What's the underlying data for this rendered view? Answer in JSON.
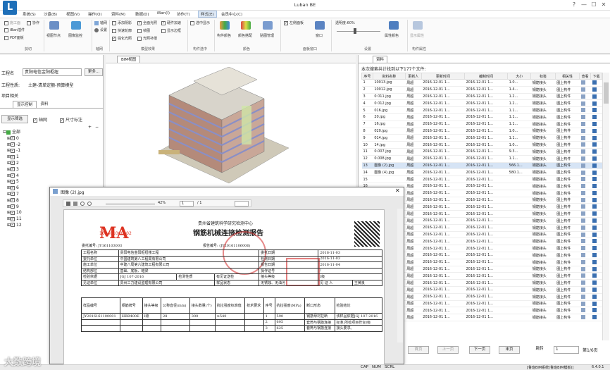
{
  "app": {
    "logo": "L",
    "title": "Luban BE"
  },
  "window_controls": {
    "help": "?",
    "min": "—",
    "max": "☐",
    "close": "✕"
  },
  "menu": [
    "系统(S)",
    "沙盘(B)",
    "视图(V)",
    "操作(O)",
    "资料(M)",
    "数据(D)",
    "iBan(I)",
    "协作(T)",
    "样式(E)",
    "会员中心(C)"
  ],
  "ribbon": {
    "groups": [
      "剪切",
      "轴网",
      "模型效果",
      "构件选中",
      "颜色",
      "面板窗口",
      "设置",
      "构件属性"
    ],
    "items": {
      "cut": "施工面",
      "xiezuo": "协作",
      "iban": "iBan插件",
      "pdf": "PDF面板",
      "jiedian": "视图节点",
      "monitor": "图像监控",
      "axis": "轴网",
      "setting": "设置",
      "add_shadow": "添加阴影",
      "full_light": "全面光照",
      "hard_accel": "硬件加速",
      "select_show": "选中显示",
      "fast_outline": "快速轮廓",
      "frame": "帧图",
      "show_border": "显示边框",
      "strong_light": "强化光照",
      "light_ratio": "光照补偿",
      "struct_color": "构件颜色",
      "color_scheme": "颜色搭配",
      "paint": "贴图管理",
      "left_panel": "左侧面板",
      "window": "窗口",
      "transparency": "透明度:60%",
      "prop_color": "属性颜色",
      "prop_info": "显示属性"
    }
  },
  "left_panel": {
    "project_label": "工程名",
    "project_value": "贵阳电信金阳枢纽",
    "more": "更多...",
    "type_label": "工程性质:",
    "type_value": "土建-清单定额-预算模型",
    "related": "项目相关",
    "tabs": [
      "显示控制",
      "资料"
    ],
    "filter_btn": "显示筛选",
    "axis_cb": "轴网",
    "dim_cb": "尺寸标注",
    "tree": [
      "全部",
      "0",
      "-2",
      "-1",
      "1",
      "2",
      "3",
      "4",
      "5",
      "6",
      "7",
      "8",
      "9",
      "10",
      "11",
      "12"
    ]
  },
  "bim": {
    "tab": "BIM视图"
  },
  "right_panel": {
    "tab": "资料",
    "summary": "本次搜索共计找到以下177个文件:",
    "columns": [
      "序号",
      "资料名称",
      "更新人",
      "更新时间",
      "编制时间",
      "大小",
      "标签",
      "相关性",
      "查看",
      "下载"
    ],
    "rows": [
      [
        "1",
        "10013.jpg",
        "周超",
        "2016-12-01 1...",
        "2016-12-01 1...",
        "1.0...",
        "钢筋接头",
        "图上构件"
      ],
      [
        "2",
        "10012.jpg",
        "周超",
        "2016-12-01 1...",
        "2016-12-01 1...",
        "1.4...",
        "钢筋接头",
        "图上构件"
      ],
      [
        "3",
        "0 011.jpg",
        "周超",
        "2016-12-01 1...",
        "2016-12-01 1...",
        "1.2...",
        "钢筋接头",
        "图上构件"
      ],
      [
        "4",
        "0 012.jpg",
        "周超",
        "2016-12-01 1...",
        "2016-12-01 1...",
        "1.2...",
        "钢筋接头",
        "图上构件"
      ],
      [
        "5",
        "016.jpg",
        "周超",
        "2016-12-01 1...",
        "2016-12-01 1...",
        "1.1...",
        "钢筋接头",
        "图上构件"
      ],
      [
        "6",
        "20.jpg",
        "周超",
        "2016-12-01 1...",
        "2016-12-01 1...",
        "1.1...",
        "钢筋接头",
        "图上构件"
      ],
      [
        "7",
        "16.jpg",
        "周超",
        "2016-12-01 1...",
        "2016-12-01 1...",
        "1.1...",
        "钢筋接头",
        "图上构件"
      ],
      [
        "8",
        "020.jpg",
        "周超",
        "2016-12-01 1...",
        "2016-12-01 1...",
        "1.0...",
        "钢筋接头",
        "图上构件"
      ],
      [
        "9",
        "014.jpg",
        "周超",
        "2016-12-01 1...",
        "2016-12-01 1...",
        "1.1...",
        "钢筋接头",
        "图上构件"
      ],
      [
        "10",
        "14.jpg",
        "周超",
        "2016-12-01 1...",
        "2016-12-01 1...",
        "1.0...",
        "钢筋接头",
        "图上构件"
      ],
      [
        "11",
        "0.007.jpg",
        "周超",
        "2016-12-01 1...",
        "2016-12-01 1...",
        "9.3...",
        "钢筋接头",
        "图上构件"
      ],
      [
        "12",
        "0.008.jpg",
        "周超",
        "2016-12-01 1...",
        "2016-12-01 1...",
        "1.1...",
        "钢筋接头",
        "图上构件"
      ],
      [
        "13",
        "图像 (2).jpg",
        "周超",
        "2016-12-01 1...",
        "2016-12-01 1...",
        "566.1...",
        "钢筋接头",
        "图上构件"
      ],
      [
        "14",
        "图像 (4).jpg",
        "周超",
        "2016-12-01 1...",
        "2016-12-01 1...",
        "580.1...",
        "钢筋接头",
        "图上构件"
      ],
      [
        "15",
        "",
        "周超",
        "2016-12-01 1...",
        "2016-12-01 1...",
        "",
        "钢筋接头",
        "图上构件"
      ],
      [
        "16",
        "",
        "周超",
        "2016-12-01 1...",
        "2016-12-01 1...",
        "",
        "钢筋接头",
        "图上构件"
      ],
      [
        "17",
        "",
        "周超",
        "2016-12-01 1...",
        "2016-12-01 1...",
        "",
        "钢筋接头",
        "图上构件"
      ],
      [
        "18",
        "",
        "周超",
        "2016-12-01 1...",
        "2016-12-01 1...",
        "",
        "钢筋接头",
        "图上构件"
      ],
      [
        "19",
        "",
        "周超",
        "2016-12-01 1...",
        "2016-12-01 1...",
        "",
        "钢筋接头",
        "图上构件"
      ],
      [
        "20",
        "",
        "周超",
        "2016-12-01 1...",
        "2016-12-01 1...",
        "",
        "钢筋接头",
        "图上构件"
      ],
      [
        "21",
        "",
        "周超",
        "2016-12-01 1...",
        "2016-12-01 1...",
        "",
        "钢筋接头",
        "图上构件"
      ],
      [
        "22",
        "",
        "周超",
        "2016-12-01 1...",
        "2016-12-01 1...",
        "",
        "钢筋接头",
        "图上构件"
      ],
      [
        "23",
        "",
        "周超",
        "2016-12-01 1...",
        "2016-12-01 1...",
        "",
        "钢筋接头",
        "图上构件"
      ],
      [
        "24",
        "",
        "周超",
        "2016-12-01 1...",
        "2016-12-01 1...",
        "",
        "钢筋接头",
        "图上构件"
      ],
      [
        "25",
        "",
        "周超",
        "2016-12-01 1...",
        "2016-12-01 1...",
        "",
        "钢筋接头",
        "图上构件"
      ],
      [
        "26",
        "",
        "周超",
        "2016-12-01 1...",
        "2016-12-01 1...",
        "",
        "钢筋接头",
        "图上构件"
      ],
      [
        "27",
        "",
        "周超",
        "2016-12-01 1...",
        "2016-12-01 1...",
        "",
        "钢筋接头",
        "图上构件"
      ],
      [
        "28",
        "",
        "周超",
        "2016-12-01 1...",
        "2016-12-01 1...",
        "",
        "钢筋接头",
        "图上构件"
      ],
      [
        "29",
        "",
        "周超",
        "2016-12-01 1...",
        "2016-12-01 1...",
        "",
        "钢筋接头",
        "图上构件"
      ],
      [
        "30",
        "",
        "周超",
        "2016-12-01 1...",
        "2016-12-01 1...",
        "",
        "钢筋接头",
        "图上构件"
      ],
      [
        "31",
        "",
        "周超",
        "2016-12-01 1...",
        "2016-12-01 1...",
        "",
        "钢筋接头",
        "图上构件"
      ],
      [
        "32",
        "",
        "周超",
        "2016-12-01 1...",
        "2016-12-01 1...",
        "",
        "钢筋接头",
        "图上构件"
      ],
      [
        "33",
        "",
        "周超",
        "2016-12-01 1...",
        "2016-12-01 1...",
        "",
        "钢筋接头",
        "图上构件"
      ],
      [
        "34",
        "",
        "周超",
        "2016-12-01 1...",
        "2016-12-01 1...",
        "",
        "钢筋接头",
        "图上构件"
      ],
      [
        "35",
        "",
        "周超",
        "2016-12-01 1...",
        "2016-12-01 1...",
        "",
        "钢筋接头",
        "图上构件"
      ]
    ],
    "pager": {
      "first": "首页",
      "prev": "上一页",
      "next": "下一页",
      "last": "末页",
      "jump": "跳转",
      "page_value": "1",
      "page_of": "第1/6页"
    }
  },
  "dialog": {
    "title": "图像 (2).jpg",
    "zoom": "42%",
    "page": "1",
    "pages": "/ 1",
    "doc": {
      "stamp": "MA",
      "stamp_code": "162401060202",
      "org": "贵州省建筑科学研究检测中心",
      "heading": "钢筋机械连接检测报告",
      "entrust_no": "委托编号: JY161103003",
      "report_no": "报告编号: (JY20161106006)",
      "r1": [
        "工程名称",
        "贵阳电信金阳枢纽楼工程",
        "委托日期",
        "2016-11-03"
      ],
      "r2": [
        "委托单位",
        "中国建筑第八工程局有限公司",
        "检测日期",
        "2016-11-03"
      ],
      "r3": [
        "施工单位",
        "中建八局第六建筑工程有限公司",
        "报告日期",
        "2016-11-04"
      ],
      "r4": [
        "结构部位",
        "基础、底板、暗梁",
        "操作证号",
        "/"
      ],
      "r5": [
        "检验依据",
        "JGJ 107-2016",
        "检测性质",
        "有见证送检",
        "接头等级",
        "I级"
      ],
      "r6": [
        "见证单位",
        "贵州三力建设监理有限公司",
        "样品状态",
        "无锈蚀、无油污",
        "见 证 人",
        "王黄良"
      ],
      "h": [
        "样品编号",
        "钢筋牌号",
        "接头等级",
        "公称直径(mm)",
        "接头数量(个)",
        "抗拉强度标准值",
        "技术要求",
        "序号",
        "抗拉强度(MPa)",
        "断口形态",
        "检验结论"
      ],
      "d1": [
        "JY2016161100001",
        "HRB400E",
        "I级",
        "28",
        "300",
        "≥540",
        "1",
        "590",
        "钢筋母材拉断",
        "该样品依据JGJ 107-2016"
      ],
      "d2": [
        "",
        "",
        "",
        "",
        "",
        "",
        "2",
        "605",
        "套筒与钢筋连接",
        "标准,所检项目符合I级"
      ],
      "d3": [
        "",
        "",
        "",
        "",
        "",
        "",
        "3",
        "625",
        "套筒与钢筋连接",
        "接头要求。"
      ]
    }
  },
  "status": {
    "caps": "CAP",
    "num": "NUM",
    "scrl": "SCRL",
    "license": "[鲁班BIM系统(鲁班BIM模板)]",
    "version": "6.4.0.1"
  },
  "watermark": "大数跨境"
}
